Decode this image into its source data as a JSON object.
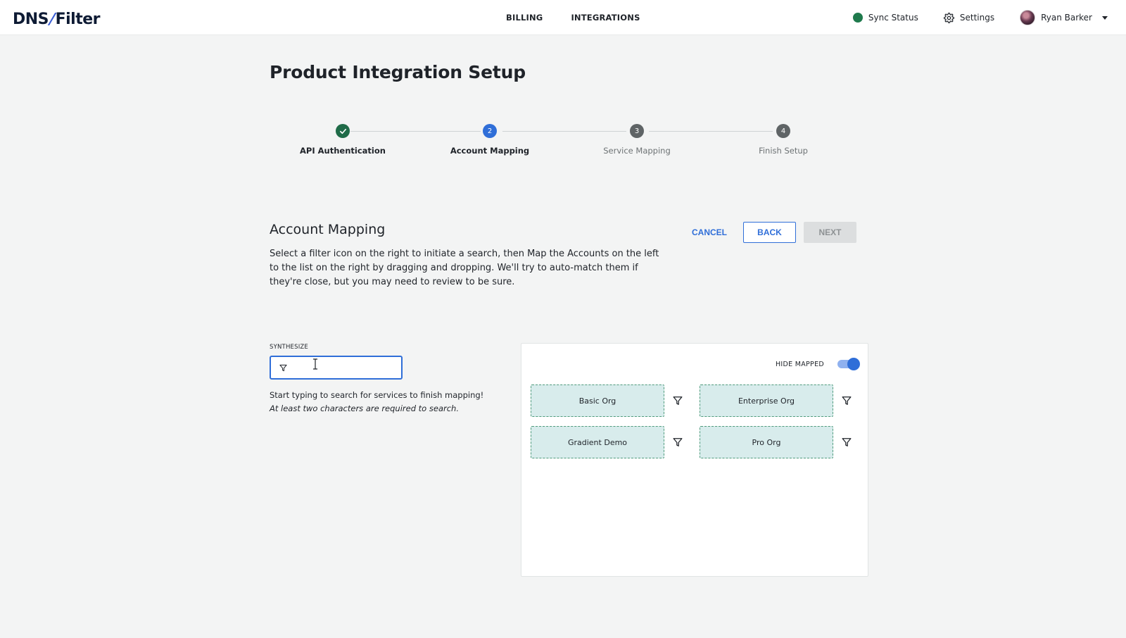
{
  "header": {
    "logo_left": "DNS",
    "logo_slash": "/",
    "logo_right": "Filter",
    "nav": [
      "BILLING",
      "INTEGRATIONS"
    ],
    "sync_status": "Sync Status",
    "settings": "Settings",
    "user": "Ryan Barker",
    "colors": {
      "sync_dot": "#1f7a4d"
    }
  },
  "page": {
    "title": "Product Integration Setup"
  },
  "stepper": {
    "steps": [
      {
        "label": "API Authentication",
        "number": "1",
        "state": "done"
      },
      {
        "label": "Account Mapping",
        "number": "2",
        "state": "active"
      },
      {
        "label": "Service Mapping",
        "number": "3",
        "state": "pending"
      },
      {
        "label": "Finish Setup",
        "number": "4",
        "state": "pending"
      }
    ]
  },
  "section": {
    "title": "Account Mapping",
    "description": "Select a filter icon on the right to initiate a search, then Map the Accounts on the left to the list on the right by dragging and dropping. We'll try to auto-match them if they're close, but you may need to review to be sure.",
    "buttons": {
      "cancel": "CANCEL",
      "back": "BACK",
      "next": "NEXT"
    }
  },
  "search": {
    "label": "SYNTHESIZE",
    "value": "",
    "hint": "Start typing to search for services to finish mapping!",
    "hint_italic": "At least two characters are required to search."
  },
  "mapping_panel": {
    "hide_mapped_label": "HIDE MAPPED",
    "hide_mapped_on": true,
    "accounts": [
      "Basic Org",
      "Enterprise Org",
      "Gradient Demo",
      "Pro Org"
    ]
  },
  "colors": {
    "accent": "#2f6ed8",
    "step_done": "#1f6b48",
    "card_bg": "#d8ecec",
    "card_border": "#4f9b7c"
  }
}
